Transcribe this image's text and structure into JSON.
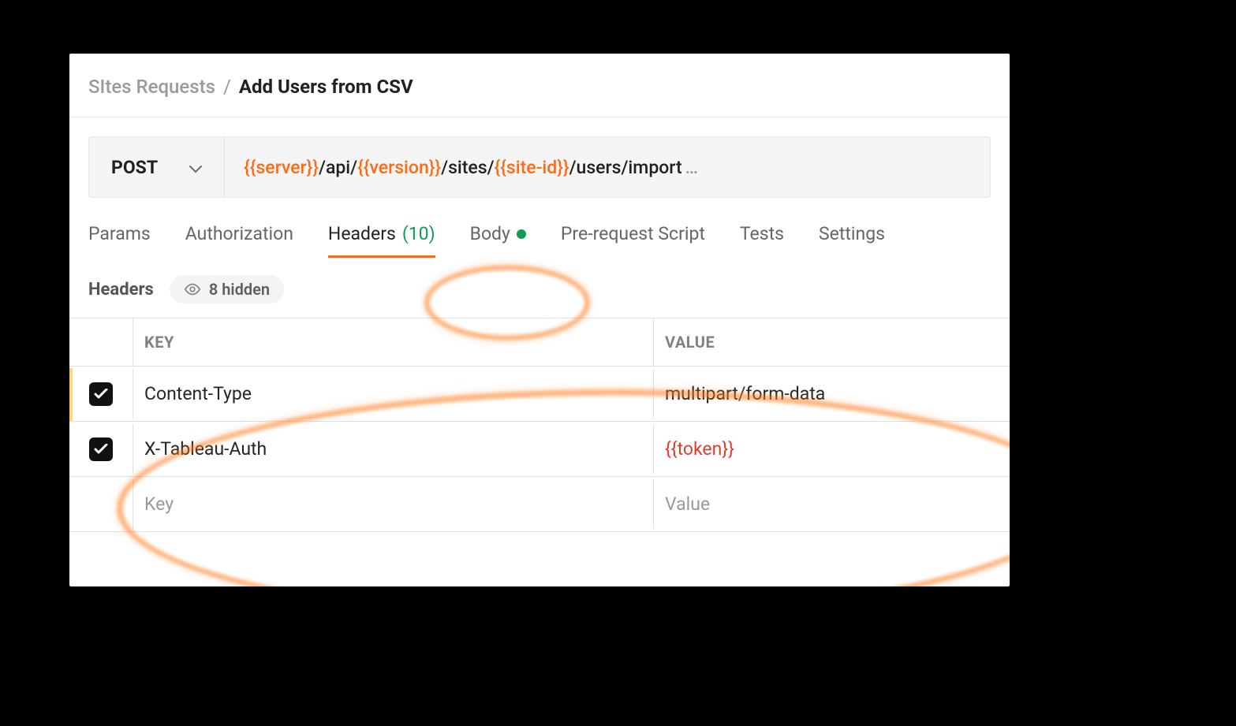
{
  "breadcrumb": {
    "parent": "SItes Requests",
    "sep": "/",
    "current": "Add Users from CSV"
  },
  "request": {
    "method": "POST",
    "url_segments": [
      {
        "text": "{{server}}",
        "var": true
      },
      {
        "text": "/api/",
        "var": false
      },
      {
        "text": "{{version}}",
        "var": true
      },
      {
        "text": "/sites/",
        "var": false
      },
      {
        "text": "{{site-id}}",
        "var": true
      },
      {
        "text": "/users/import",
        "var": false
      }
    ],
    "ellipsis": "…"
  },
  "tabs": {
    "params": "Params",
    "authorization": "Authorization",
    "headers_label": "Headers",
    "headers_count": "(10)",
    "body": "Body",
    "pre_request": "Pre-request Script",
    "tests": "Tests",
    "settings": "Settings"
  },
  "headers_section": {
    "label": "Headers",
    "hidden_count": "8 hidden",
    "columns": {
      "key": "KEY",
      "value": "VALUE"
    },
    "rows": [
      {
        "enabled": true,
        "key": "Content-Type",
        "value": "multipart/form-data",
        "value_is_var": false
      },
      {
        "enabled": true,
        "key": "X-Tableau-Auth",
        "value": "{{token}}",
        "value_is_var": true
      }
    ],
    "placeholder": {
      "key": "Key",
      "value": "Value"
    }
  }
}
